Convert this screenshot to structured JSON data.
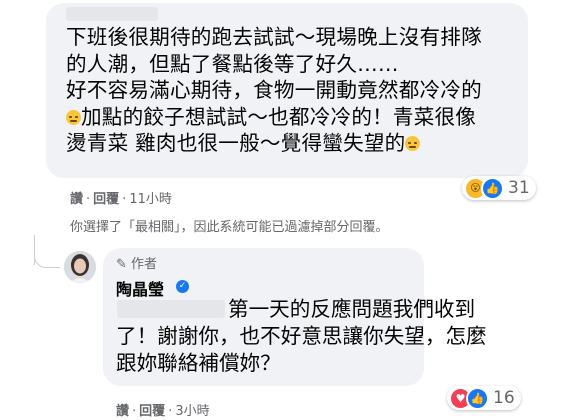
{
  "comment1": {
    "lines": [
      "下班後很期待的跑去試試～現場晚上沒有排隊",
      "的人潮，但點了餐點後等了好久……",
      "好不容易滿心期待，食物一開動竟然都冷冷的",
      "加點的餃子想試試～也都冷冷的！青菜很像",
      "燙青菜 雞肉也很一般～覺得蠻失望的"
    ],
    "reaction_count": "31",
    "reactions": [
      "wow-icon",
      "like-icon"
    ],
    "actions": {
      "like": "讚",
      "reply": "回覆"
    },
    "time": "11小時"
  },
  "filter_note": "你選擇了「最相關」，因此系統可能已過濾掉部分回覆。",
  "reply": {
    "badge": "作者",
    "author": "陶晶瑩",
    "lines": [
      "第一天的反應問題我們收到",
      "了！謝謝你，也不好意思讓你失望，怎麼",
      "跟妳聯絡補償妳？"
    ],
    "reaction_count": "16",
    "reactions": [
      "love-icon",
      "like-icon"
    ],
    "actions": {
      "like": "讚",
      "reply": "回覆"
    },
    "time": "3小時"
  },
  "colors": {
    "bubble": "#f0f2f5",
    "meta": "#65676b",
    "like": "#1877f2",
    "love": "#f33e58",
    "wow": "#f7b928"
  }
}
